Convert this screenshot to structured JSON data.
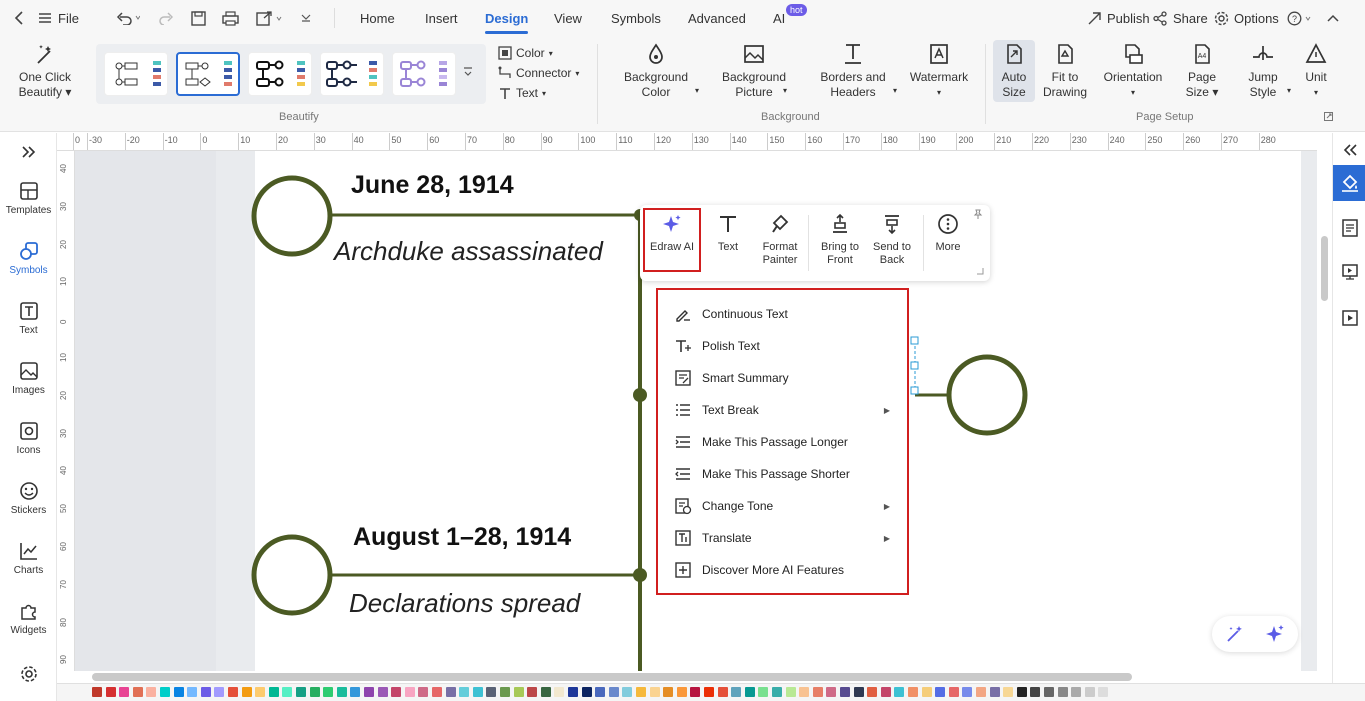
{
  "menubar": {
    "file": "File",
    "tabs": [
      {
        "label": "Home"
      },
      {
        "label": "Insert"
      },
      {
        "label": "Design"
      },
      {
        "label": "View"
      },
      {
        "label": "Symbols"
      },
      {
        "label": "Advanced"
      },
      {
        "label": "AI"
      }
    ],
    "ai_badge": "hot",
    "active_tab": "Design",
    "publish": "Publish",
    "share": "Share",
    "options": "Options",
    "help": "?"
  },
  "ribbon": {
    "one_click_beautify": [
      "One Click",
      "Beautify"
    ],
    "beautify_group": "Beautify",
    "color": "Color",
    "connector": "Connector",
    "text": "Text",
    "background_color": [
      "Background",
      "Color"
    ],
    "background_picture": [
      "Background",
      "Picture"
    ],
    "borders_headers": [
      "Borders and",
      "Headers"
    ],
    "watermark": "Watermark",
    "background_group": "Background",
    "auto_size": [
      "Auto",
      "Size"
    ],
    "fit_to_drawing": [
      "Fit to",
      "Drawing"
    ],
    "orientation": "Orientation",
    "page_size": [
      "Page",
      "Size"
    ],
    "jump_style": [
      "Jump",
      "Style"
    ],
    "unit": "Unit",
    "page_setup_group": "Page Setup"
  },
  "leftbar": {
    "items": [
      {
        "label": "Templates",
        "icon": "templates-icon"
      },
      {
        "label": "Symbols",
        "icon": "symbols-icon"
      },
      {
        "label": "Text",
        "icon": "text-icon"
      },
      {
        "label": "Images",
        "icon": "images-icon"
      },
      {
        "label": "Icons",
        "icon": "icons-icon"
      },
      {
        "label": "Stickers",
        "icon": "stickers-icon"
      },
      {
        "label": "Charts",
        "icon": "charts-icon"
      },
      {
        "label": "Widgets",
        "icon": "widgets-icon"
      }
    ]
  },
  "rulers": {
    "h_ticks": [
      "0",
      "-30",
      "-20",
      "-10",
      "0",
      "10",
      "20",
      "30",
      "40",
      "50",
      "60",
      "70",
      "80",
      "90",
      "100",
      "110",
      "120",
      "130",
      "140",
      "150",
      "160",
      "170",
      "180",
      "190",
      "200",
      "210",
      "220",
      "230",
      "240",
      "250",
      "260",
      "270",
      "280"
    ],
    "v_ticks": [
      "40",
      "30",
      "20",
      "10",
      "0",
      "10",
      "20",
      "30",
      "40",
      "50",
      "60",
      "70",
      "80",
      "90"
    ]
  },
  "timeline": {
    "event1_date": "June 28, 1914",
    "event1_desc": "Archduke assassinated",
    "event2_date": "August 1–28, 1914",
    "event2_desc": "Declarations spread"
  },
  "floatbar": {
    "edraw_ai": "Edraw AI",
    "text": "Text",
    "format_painter": [
      "Format",
      "Painter"
    ],
    "bring_to_front": [
      "Bring to",
      "Front"
    ],
    "send_to_back": [
      "Send to",
      "Back"
    ],
    "more": "More"
  },
  "ai_menu": {
    "items": [
      {
        "label": "Continuous Text",
        "icon": "continuous-text-icon",
        "submenu": false
      },
      {
        "label": "Polish Text",
        "icon": "polish-text-icon",
        "submenu": false
      },
      {
        "label": "Smart Summary",
        "icon": "smart-summary-icon",
        "submenu": false
      },
      {
        "label": "Text Break",
        "icon": "text-break-icon",
        "submenu": true
      },
      {
        "label": "Make This Passage Longer",
        "icon": "passage-longer-icon",
        "submenu": false
      },
      {
        "label": "Make This Passage Shorter",
        "icon": "passage-shorter-icon",
        "submenu": false
      },
      {
        "label": "Change Tone",
        "icon": "change-tone-icon",
        "submenu": true
      },
      {
        "label": "Translate",
        "icon": "translate-icon",
        "submenu": true
      },
      {
        "label": "Discover More AI Features",
        "icon": "discover-more-icon",
        "submenu": false
      }
    ]
  },
  "colors": {
    "accent": "#2b6cd4",
    "timeline_olive": "#4b5a23",
    "highlight_red": "#d11f1f",
    "ai_purple": "#5b5ce6"
  }
}
